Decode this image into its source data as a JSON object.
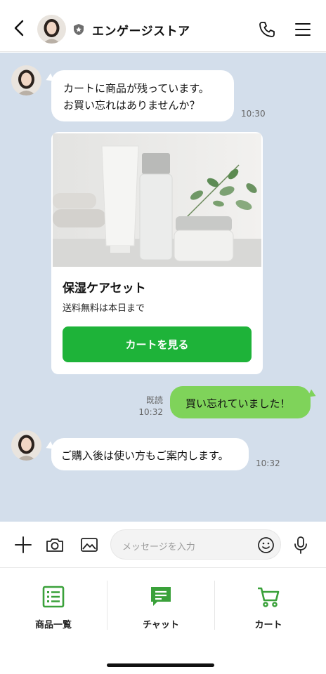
{
  "header": {
    "title": "エンゲージストア",
    "back_icon": "chevron-left-icon",
    "shield_icon": "shield-icon",
    "phone_icon": "phone-icon",
    "menu_icon": "hamburger-menu-icon"
  },
  "chat": {
    "messages": [
      {
        "line1": "カートに商品が残っています。",
        "line2": "お買い忘れはありませんか？",
        "time": "10:30"
      },
      {
        "text": "ご購入後は使い方もご案内します。",
        "time": "10:32"
      }
    ],
    "card": {
      "title": "保湿ケアセット",
      "subtitle": "送料無料は本日まで",
      "button": "カートを見る"
    },
    "reply": {
      "text": "買い忘れていました！",
      "read": "既読",
      "time": "10:32"
    },
    "colors": {
      "background": "#d3deeb",
      "reply_bubble": "#7fd35a",
      "button": "#1eb339"
    }
  },
  "input": {
    "placeholder": "メッセージを入力",
    "icons": [
      "plus-icon",
      "camera-icon",
      "image-icon",
      "smile-icon",
      "microphone-icon"
    ]
  },
  "nav": {
    "items": [
      {
        "label": "商品一覧",
        "icon": "list-icon"
      },
      {
        "label": "チャット",
        "icon": "chat-icon"
      },
      {
        "label": "カート",
        "icon": "cart-icon"
      }
    ],
    "accent": "#3aa13a"
  }
}
